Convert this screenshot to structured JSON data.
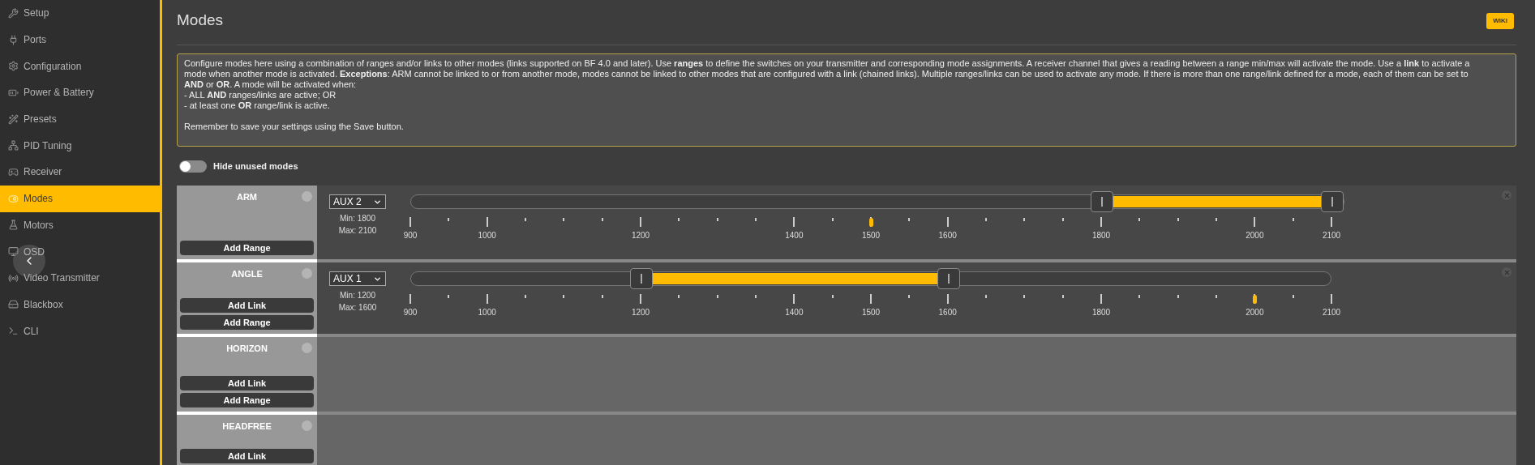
{
  "sidebar": {
    "items": [
      {
        "label": "Setup",
        "selected": false
      },
      {
        "label": "Ports",
        "selected": false
      },
      {
        "label": "Configuration",
        "selected": false
      },
      {
        "label": "Power & Battery",
        "selected": false
      },
      {
        "label": "Presets",
        "selected": false
      },
      {
        "label": "PID Tuning",
        "selected": false
      },
      {
        "label": "Receiver",
        "selected": false
      },
      {
        "label": "Modes",
        "selected": true
      },
      {
        "label": "Motors",
        "selected": false
      },
      {
        "label": "OSD",
        "selected": false
      },
      {
        "label": "Video Transmitter",
        "selected": false
      },
      {
        "label": "Blackbox",
        "selected": false
      },
      {
        "label": "CLI",
        "selected": false
      }
    ]
  },
  "page": {
    "title": "Modes",
    "wiki_button": "WIKI",
    "description": {
      "paragraph": "Configure modes here using a combination of ranges and/or links to other modes (links supported on BF 4.0 and later). Use **ranges** to define the switches on your transmitter and corresponding mode assignments. A receiver channel that gives a reading between a range min/max will activate the mode. Use a **link** to activate a mode when another mode is activated. **Exceptions**: ARM cannot be linked to or from another mode, modes cannot be linked to other modes that are configured with a link (chained links). Multiple ranges/links can be used to activate any mode. If there is more than one range/link defined for a mode, each of them can be set to **AND** or **OR**. A mode will be activated when:",
      "conditions": [
        "- ALL **AND** ranges/links are active; OR",
        "- at least one **OR** range/link is active."
      ],
      "reminder": "Remember to save your settings using the Save button."
    }
  },
  "hide_unused": {
    "label": "Hide unused modes",
    "on": false
  },
  "modes": [
    {
      "name": "ARM",
      "buttons": [
        "Add Range"
      ],
      "ranges": [
        {
          "channel": "AUX 2",
          "min": "Min: 1800",
          "max": "Max: 2100",
          "current": {
            "level": 0.5
          },
          "handles": [
            {
              "level": 0.75
            },
            {
              "level": 1
            }
          ],
          "scale": [
            "900",
            "1000",
            "1200",
            "1400",
            "1500",
            "1600",
            "1800",
            "2000",
            "2100"
          ]
        }
      ]
    },
    {
      "name": "ANGLE",
      "buttons": [
        "Add Link",
        "Add Range"
      ],
      "ranges": [
        {
          "channel": "AUX 1",
          "min": "Min: 1200",
          "max": "Max: 1600",
          "current": {
            "level": 0.9167
          },
          "handles": [
            {
              "level": 0.25
            },
            {
              "level": 0.5833
            }
          ],
          "scale": [
            "900",
            "1000",
            "1200",
            "1400",
            "1500",
            "1600",
            "1800",
            "2000",
            "2100"
          ]
        }
      ]
    },
    {
      "name": "HORIZON",
      "buttons": [
        "Add Link",
        "Add Range"
      ]
    },
    {
      "name": "HEADFREE",
      "buttons": [
        "Add Link"
      ]
    }
  ]
}
